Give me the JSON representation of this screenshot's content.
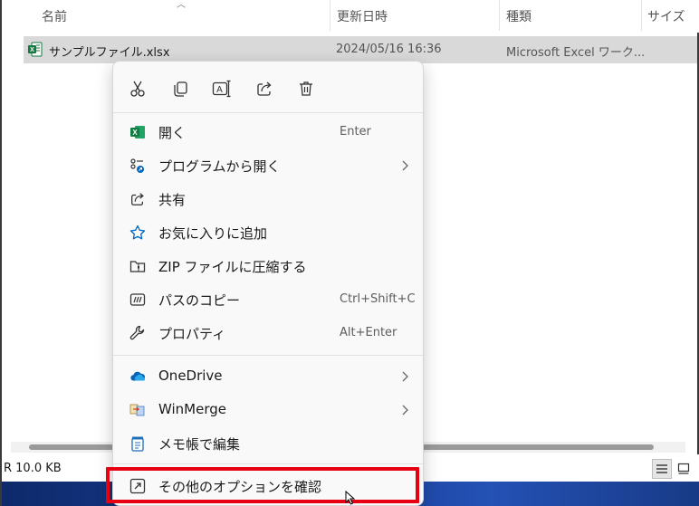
{
  "columns": {
    "name": "名前",
    "modified": "更新日時",
    "type": "種類",
    "size": "サイズ"
  },
  "file": {
    "name": "サンプルファイル.xlsx",
    "modified": "2024/05/16 16:36",
    "type": "Microsoft Excel ワーク..."
  },
  "status": {
    "size_text": "R 10.0 KB"
  },
  "quick_actions": [
    {
      "name": "cut",
      "icon": "scissors-icon"
    },
    {
      "name": "copy",
      "icon": "copy-icon"
    },
    {
      "name": "rename",
      "icon": "rename-icon"
    },
    {
      "name": "share",
      "icon": "share-icon"
    },
    {
      "name": "delete",
      "icon": "trash-icon"
    }
  ],
  "menu": {
    "open": {
      "label": "開く",
      "shortcut": "Enter",
      "icon": "excel-icon"
    },
    "open_with": {
      "label": "プログラムから開く",
      "icon": "open-with-icon"
    },
    "share": {
      "label": "共有",
      "icon": "share-icon"
    },
    "favorite": {
      "label": "お気に入りに追加",
      "icon": "star-icon"
    },
    "zip": {
      "label": "ZIP ファイルに圧縮する",
      "icon": "zip-folder-icon"
    },
    "copy_path": {
      "label": "パスのコピー",
      "shortcut": "Ctrl+Shift+C",
      "icon": "path-icon"
    },
    "properties": {
      "label": "プロパティ",
      "shortcut": "Alt+Enter",
      "icon": "wrench-icon"
    },
    "onedrive": {
      "label": "OneDrive",
      "icon": "cloud-icon"
    },
    "winmerge": {
      "label": "WinMerge",
      "icon": "winmerge-icon"
    },
    "notepad": {
      "label": "メモ帳で編集",
      "icon": "notepad-icon"
    },
    "more_options": {
      "label": "その他のオプションを確認",
      "icon": "more-options-icon"
    }
  },
  "colors": {
    "highlight": "#e60012",
    "accent": "#0067c0",
    "excel_green": "#107c41"
  }
}
